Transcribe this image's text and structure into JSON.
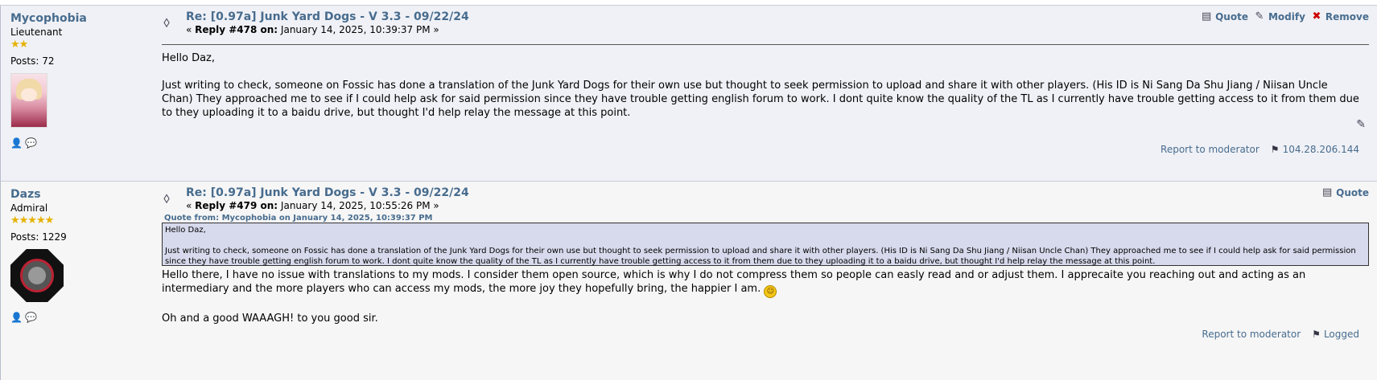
{
  "posts": [
    {
      "author": "Mycophobia",
      "rank": "Lieutenant",
      "stars": "★★",
      "posts_count": "Posts: 72",
      "subject": "Re: [0.97a] Junk Yard Dogs - V 3.3 - 09/22/24",
      "reply_prefix": "« ",
      "reply_label": "Reply #478 on:",
      "reply_date": " January 14, 2025, 10:39:37 PM »",
      "actions": {
        "quote": "Quote",
        "modify": "Modify",
        "remove": "Remove"
      },
      "body": [
        "Hello Daz,",
        "Just writing to check, someone on Fossic has done a translation of the Junk Yard Dogs for their own use but thought to seek permission to upload and share it with other players. (His ID is Ni Sang Da Shu Jiang / Niisan Uncle Chan) They approached me to see if I could help ask for said permission since they have trouble getting english forum to work. I dont quite know the quality of the TL as I currently have trouble getting access to it from them due to they uploading it to a baidu drive, but thought I'd help relay the message at this point."
      ],
      "report": "Report to moderator",
      "ip": "104.28.206.144"
    },
    {
      "author": "Dazs",
      "rank": "Admiral",
      "stars": "★★★★★",
      "posts_count": "Posts: 1229",
      "subject": "Re: [0.97a] Junk Yard Dogs - V 3.3 - 09/22/24",
      "reply_prefix": "« ",
      "reply_label": "Reply #479 on:",
      "reply_date": " January 14, 2025, 10:55:26 PM »",
      "actions": {
        "quote": "Quote"
      },
      "quote_header": "Quote from: Mycophobia on January 14, 2025, 10:39:37 PM",
      "quote_body": [
        "Hello Daz,",
        "Just writing to check, someone on Fossic has done a translation of the Junk Yard Dogs for their own use but thought to seek permission to upload and share it with other players. (His ID is Ni Sang Da Shu Jiang / Niisan Uncle Chan) They approached me to see if I could help ask for said permission since they have trouble getting english forum to work. I dont quite know the quality of the TL as I currently have trouble getting access to it from them due to they uploading it to a baidu drive, but thought I'd help relay the message at this point."
      ],
      "body": [
        "Hello there, I have no issue with translations to my mods. I consider them open source, which is why I do not compress them so people can easly read and or adjust them. I apprecaite you reaching out and acting as an intermediary and the more players who can access my mods, the more joy they hopefully bring, the happier I am.",
        "Oh and a good WAAAGH! to you good sir."
      ],
      "report": "Report to moderator",
      "logged": "Logged"
    }
  ],
  "colors": {
    "link": "#476c8e",
    "post_bg_1": "#f0f1f6",
    "post_bg_2": "#f6f6f6",
    "quote_bg": "#d7daec"
  }
}
